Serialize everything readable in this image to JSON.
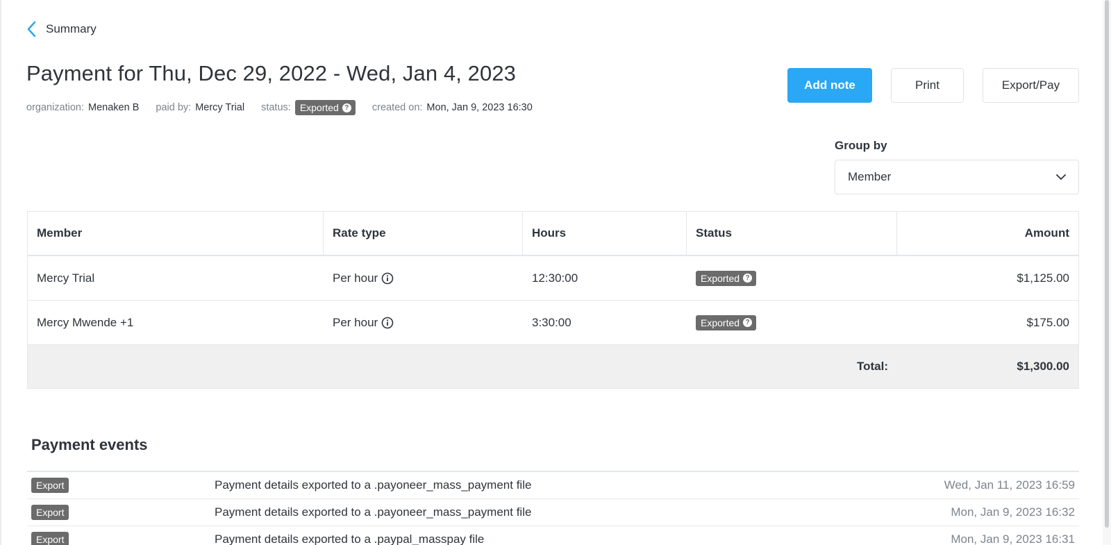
{
  "nav": {
    "back_label": "Summary"
  },
  "header": {
    "title": "Payment for Thu, Dec 29, 2022 - Wed, Jan 4, 2023",
    "meta": {
      "organization_label": "organization:",
      "organization_value": "Menaken B",
      "paid_by_label": "paid by:",
      "paid_by_value": "Mercy Trial",
      "status_label": "status:",
      "status_value": "Exported",
      "created_on_label": "created on:",
      "created_on_value": "Mon, Jan 9, 2023 16:30"
    }
  },
  "actions": {
    "add_note": "Add note",
    "print": "Print",
    "export_pay": "Export/Pay"
  },
  "group_by": {
    "label": "Group by",
    "selected": "Member"
  },
  "table": {
    "columns": [
      "Member",
      "Rate type",
      "Hours",
      "Status",
      "Amount"
    ],
    "rows": [
      {
        "member": "Mercy Trial",
        "rate_type": "Per hour",
        "hours": "12:30:00",
        "status": "Exported",
        "amount": "$1,125.00"
      },
      {
        "member": "Mercy Mwende +1",
        "rate_type": "Per hour",
        "hours": "3:30:00",
        "status": "Exported",
        "amount": "$175.00"
      }
    ],
    "total_label": "Total:",
    "total_value": "$1,300.00"
  },
  "events": {
    "title": "Payment events",
    "items": [
      {
        "type": "Export",
        "description": "Payment details exported to a .payoneer_mass_payment file",
        "date": "Wed, Jan 11, 2023 16:59"
      },
      {
        "type": "Export",
        "description": "Payment details exported to a .payoneer_mass_payment file",
        "date": "Mon, Jan 9, 2023 16:32"
      },
      {
        "type": "Export",
        "description": "Payment details exported to a .paypal_masspay file",
        "date": "Mon, Jan 9, 2023 16:31"
      }
    ]
  },
  "colors": {
    "primary": "#2aa7f5",
    "badge": "#6b6b6b",
    "text": "#2f343b",
    "muted": "#7d848d",
    "total_row_bg": "#f0f0f0"
  },
  "icons": {
    "back": "chevron-left-icon",
    "dropdown": "chevron-down-icon",
    "rate_info": "info-icon",
    "status_help": "question-icon"
  }
}
